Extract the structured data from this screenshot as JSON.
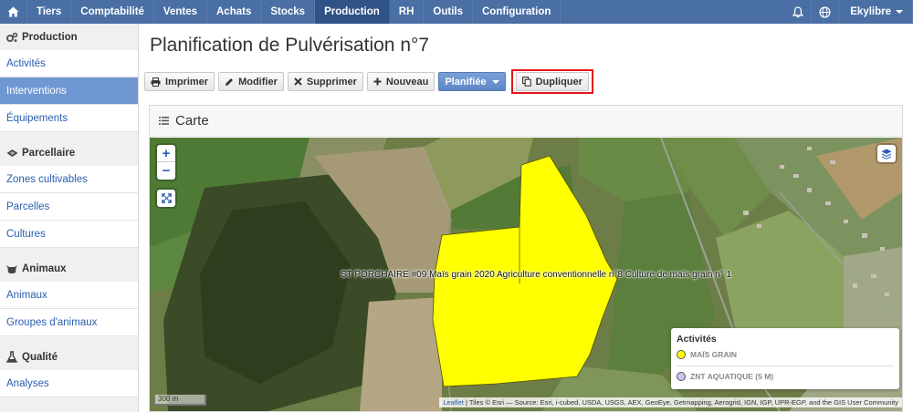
{
  "topbar": {
    "items": [
      "Tiers",
      "Comptabilité",
      "Ventes",
      "Achats",
      "Stocks",
      "Production",
      "RH",
      "Outils",
      "Configuration"
    ],
    "active": "Production",
    "user": "Ekylibre"
  },
  "sidebar": {
    "sections": [
      {
        "title": "Production",
        "icon": "gears-icon",
        "items": [
          "Activités",
          "Interventions",
          "Équipements"
        ]
      },
      {
        "title": "Parcellaire",
        "icon": "land-icon",
        "items": [
          "Zones cultivables",
          "Parcelles",
          "Cultures"
        ]
      },
      {
        "title": "Animaux",
        "icon": "cow-icon",
        "items": [
          "Animaux",
          "Groupes d'animaux"
        ]
      },
      {
        "title": "Qualité",
        "icon": "flask-icon",
        "items": [
          "Analyses"
        ]
      }
    ],
    "active_item": "Interventions"
  },
  "page": {
    "title": "Planification de Pulvérisation n°7"
  },
  "toolbar": {
    "print": "Imprimer",
    "edit": "Modifier",
    "delete": "Supprimer",
    "new": "Nouveau",
    "state": "Planifiée",
    "duplicate": "Dupliquer"
  },
  "card": {
    "title": "Carte"
  },
  "map": {
    "plot_label": "ST PORCHAIRE #09 Maïs grain 2020 Agriculture conventionnelle n°8 Culture de maïs grain n° 1",
    "zoom_in": "+",
    "zoom_out": "−",
    "scale": "300 m",
    "attribution_link": "Leaflet",
    "attribution": "| Tiles © Esri — Source: Esri, i-cubed, USDA, USGS, AEX, GeoEye, Getmapping, Aerogrid, IGN, IGP, UPR-EGP, and the GIS User Community",
    "legend": {
      "title": "Activités",
      "items": [
        {
          "label": "MAÏS GRAIN",
          "color": "#ffff00"
        },
        {
          "label": "ZNT AQUATIQUE (5 M)",
          "color": "#c9c8f0"
        }
      ]
    }
  }
}
